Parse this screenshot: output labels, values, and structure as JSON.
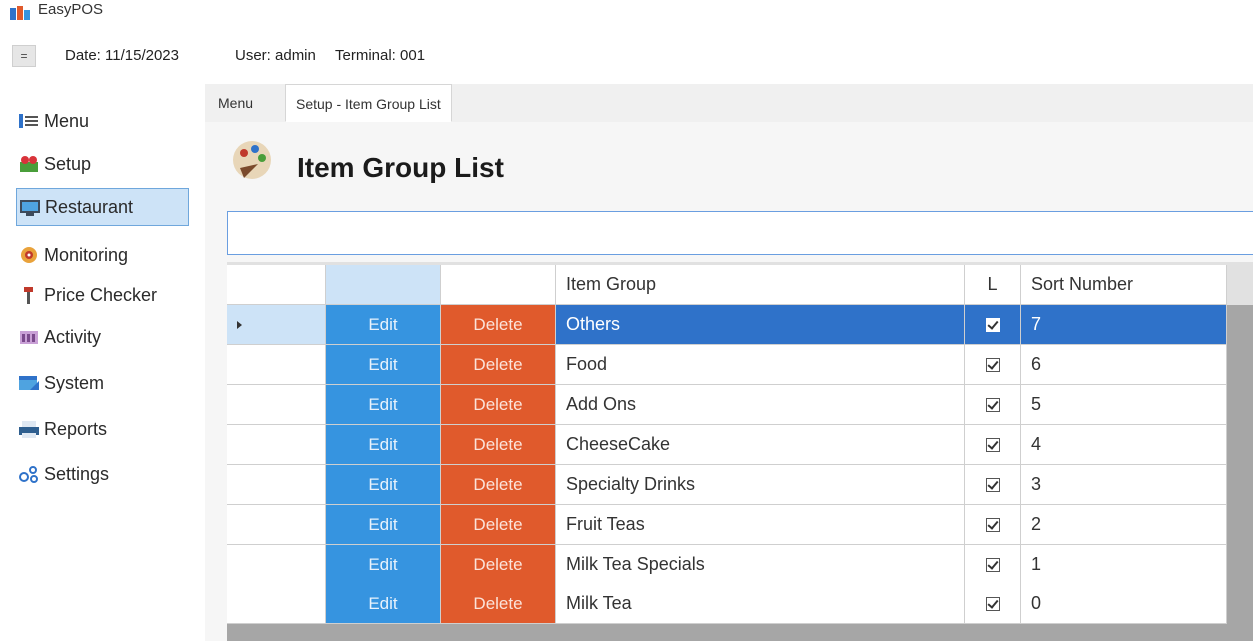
{
  "app": {
    "title": "EasyPOS"
  },
  "status": {
    "menu_glyph": "=",
    "date_label": "Date: 11/15/2023",
    "user_label": "User: admin",
    "terminal_label": "Terminal: 001"
  },
  "sidebar": {
    "items": [
      {
        "label": "Menu",
        "icon": "menu-icon"
      },
      {
        "label": "Setup",
        "icon": "setup-icon"
      },
      {
        "label": "Restaurant",
        "icon": "restaurant-icon",
        "active": true
      },
      {
        "label": "Monitoring",
        "icon": "monitoring-icon"
      },
      {
        "label": "Price Checker",
        "icon": "price-checker-icon"
      },
      {
        "label": "Activity",
        "icon": "activity-icon"
      },
      {
        "label": "System",
        "icon": "system-icon"
      },
      {
        "label": "Reports",
        "icon": "reports-icon"
      },
      {
        "label": "Settings",
        "icon": "settings-icon"
      }
    ]
  },
  "tabs": [
    {
      "label": "Menu"
    },
    {
      "label": "Setup - Item Group List",
      "active": true
    }
  ],
  "page": {
    "title": "Item Group List"
  },
  "search": {
    "value": "",
    "placeholder": ""
  },
  "grid": {
    "headers": {
      "item_group": "Item Group",
      "l": "L",
      "sort_number": "Sort Number"
    },
    "edit_label": "Edit",
    "delete_label": "Delete",
    "rows": [
      {
        "item_group": "Others",
        "l": true,
        "sort_number": "7",
        "selected": true
      },
      {
        "item_group": "Food",
        "l": true,
        "sort_number": "6"
      },
      {
        "item_group": "Add Ons",
        "l": true,
        "sort_number": "5"
      },
      {
        "item_group": "CheeseCake",
        "l": true,
        "sort_number": "4"
      },
      {
        "item_group": "Specialty Drinks",
        "l": true,
        "sort_number": "3"
      },
      {
        "item_group": "Fruit Teas",
        "l": true,
        "sort_number": "2"
      },
      {
        "item_group": "Milk Tea Specials",
        "l": true,
        "sort_number": "1"
      },
      {
        "item_group": "Milk Tea",
        "l": true,
        "sort_number": "0"
      }
    ]
  },
  "colors": {
    "edit_button": "#3694e0",
    "delete_button": "#e05a2c",
    "selected_row": "#2f72c9",
    "active_sidebar": "#cde3f7"
  }
}
